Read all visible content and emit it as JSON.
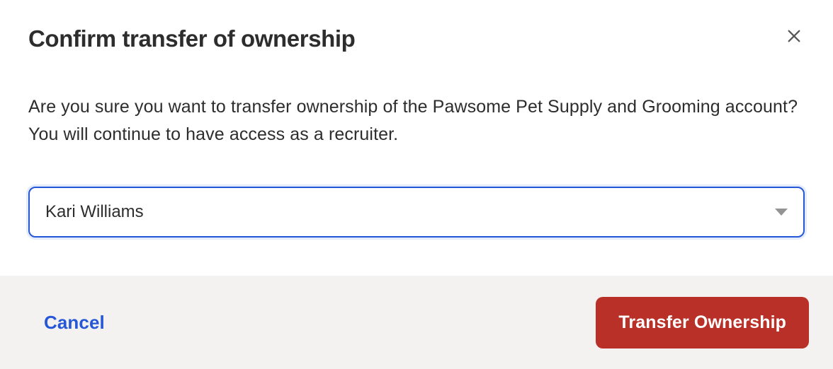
{
  "modal": {
    "title": "Confirm transfer of ownership",
    "body": "Are you sure you want to transfer ownership of the Pawsome Pet Supply and Grooming account? You will continue to have access as a recruiter.",
    "select": {
      "selected": "Kari Williams"
    },
    "footer": {
      "cancel": "Cancel",
      "confirm": "Transfer Ownership"
    }
  }
}
